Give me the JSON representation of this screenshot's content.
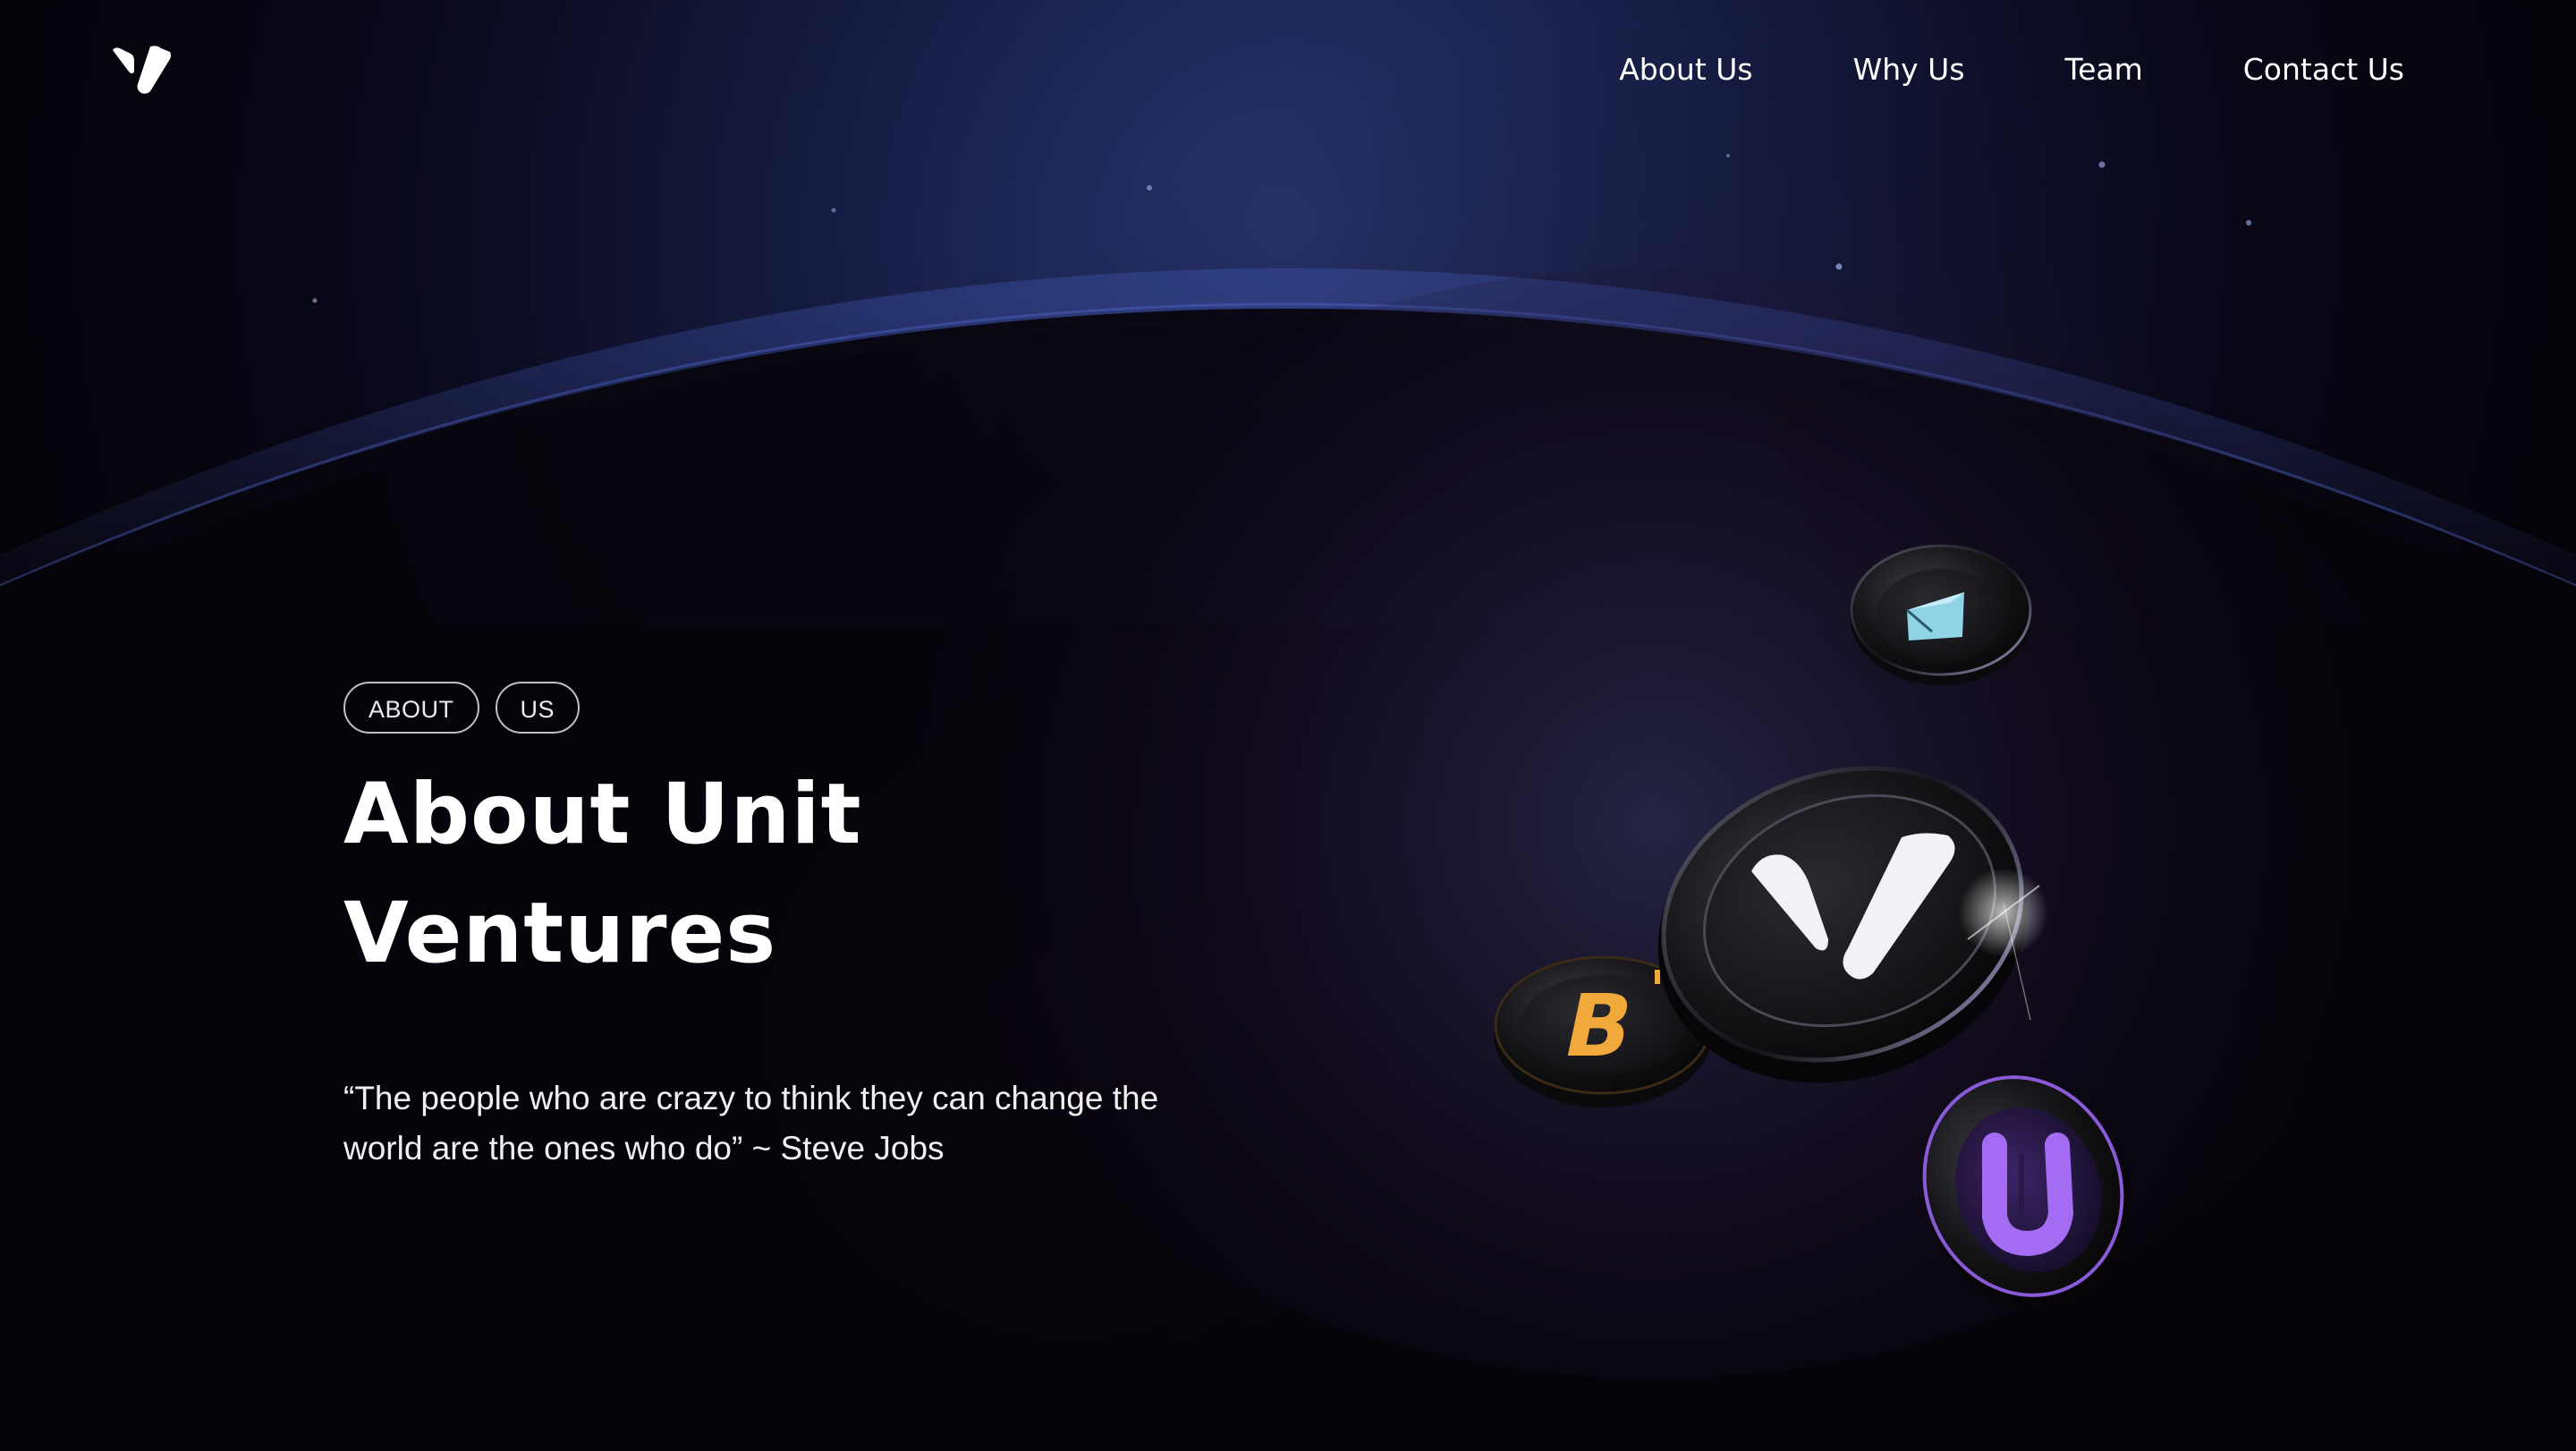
{
  "nav": {
    "logo_alt": "Unit Ventures logo",
    "links": [
      {
        "label": "About Us"
      },
      {
        "label": "Why Us"
      },
      {
        "label": "Team"
      },
      {
        "label": "Contact Us"
      }
    ]
  },
  "hero": {
    "tags": [
      "ABOUT",
      "US"
    ],
    "title": "About Unit Ventures",
    "quote": "“The people who are crazy to think they can change the world are the ones who do” ~ Steve Jobs"
  },
  "coins": [
    {
      "icon": "ethereum-box-coin-icon",
      "color": "#8fd3e6"
    },
    {
      "icon": "unit-ventures-coin-icon",
      "color": "#ffffff"
    },
    {
      "icon": "bitcoin-coin-icon",
      "color": "#f2a93b"
    },
    {
      "icon": "u-coin-icon",
      "color": "#a36cf2"
    }
  ],
  "colors": {
    "background": "#05030a",
    "glow_blue": "#2b3a78",
    "glow_purple": "#3a1f4d"
  }
}
